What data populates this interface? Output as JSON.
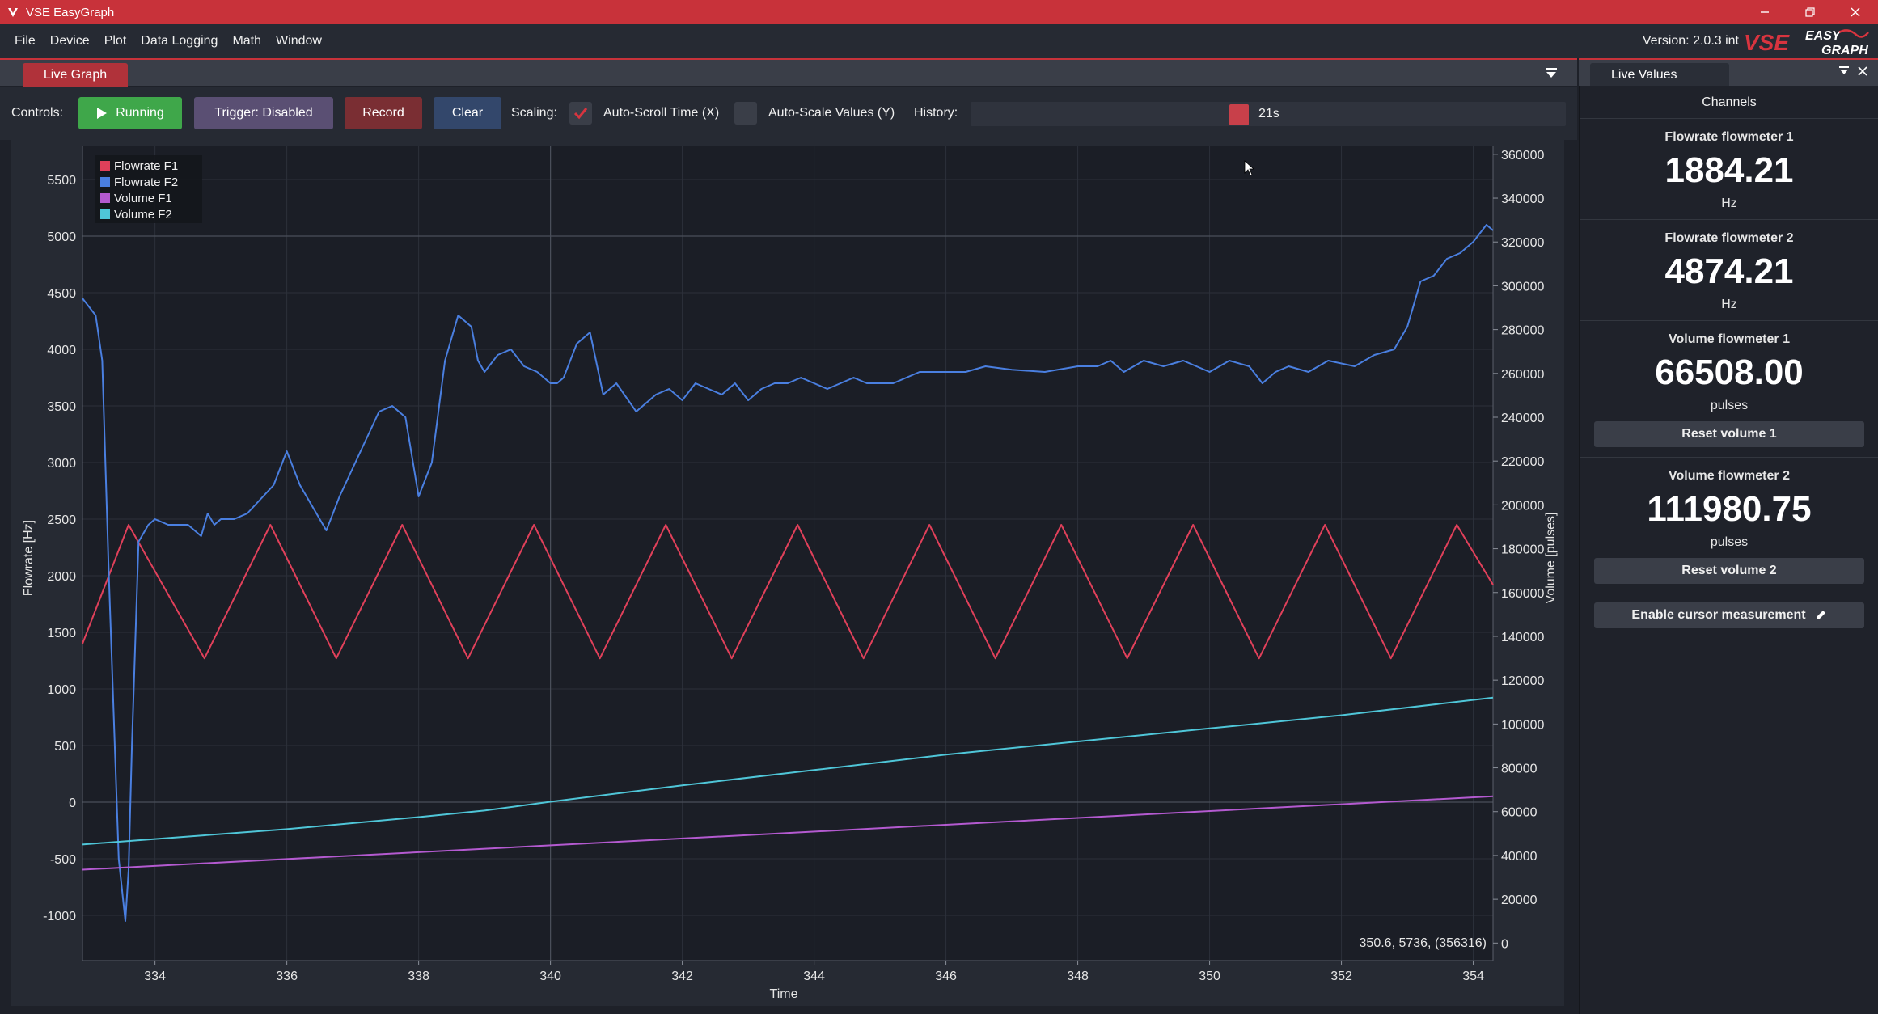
{
  "window": {
    "title": "VSE EasyGraph"
  },
  "menu": [
    "File",
    "Device",
    "Plot",
    "Data Logging",
    "Math",
    "Window"
  ],
  "version_label": "Version: 2.0.3 int",
  "logo": {
    "brand": "VSE",
    "product_line1": "EASY",
    "product_line2": "GRAPH"
  },
  "tabs": {
    "main": "Live Graph",
    "side": "Live Values"
  },
  "controls": {
    "label": "Controls:",
    "running": "Running",
    "trigger": "Trigger: Disabled",
    "record": "Record",
    "clear": "Clear",
    "scaling_label": "Scaling:",
    "autoscroll_label": "Auto-Scroll Time (X)",
    "autoscroll_checked": true,
    "autoscale_label": "Auto-Scale Values (Y)",
    "autoscale_checked": false,
    "history_label": "History:",
    "history_value": "21s"
  },
  "colors": {
    "titlebar": "#c8323a",
    "flowrate_f1": "#e0405a",
    "flowrate_f2": "#4a7fe0",
    "volume_f1": "#b45ad0",
    "volume_f2": "#4fc6d8",
    "running": "#3fa74a"
  },
  "graph": {
    "cursor_readout": "350.6, 5736, (356316)",
    "xlabel": "Time",
    "ylabel_left": "Flowrate [Hz]",
    "ylabel_right": "Volume [pulses]"
  },
  "live_values": {
    "header": "Channels",
    "channels": [
      {
        "name": "Flowrate flowmeter 1",
        "value": "1884.21",
        "unit": "Hz",
        "button": ""
      },
      {
        "name": "Flowrate flowmeter 2",
        "value": "4874.21",
        "unit": "Hz",
        "button": ""
      },
      {
        "name": "Volume flowmeter 1",
        "value": "66508.00",
        "unit": "pulses",
        "button": "Reset volume 1"
      },
      {
        "name": "Volume flowmeter 2",
        "value": "111980.75",
        "unit": "pulses",
        "button": "Reset volume 2"
      }
    ],
    "cursor_button": "Enable cursor measurement"
  },
  "chart_data": {
    "type": "line",
    "title": "",
    "xlabel": "Time",
    "ylabel": "Flowrate [Hz]",
    "y2label": "Volume [pulses]",
    "xlim": [
      332.9,
      354.3
    ],
    "ylim": [
      -1400,
      5800
    ],
    "y2lim": [
      -8000,
      364000
    ],
    "grid": true,
    "legend": "top-left",
    "x_ticks": [
      334,
      336,
      338,
      340,
      342,
      344,
      346,
      348,
      350,
      352,
      354
    ],
    "y_ticks": [
      -1000,
      -500,
      0,
      500,
      1000,
      1500,
      2000,
      2500,
      3000,
      3500,
      4000,
      4500,
      5000,
      5500
    ],
    "y2_ticks": [
      0,
      20000,
      40000,
      60000,
      80000,
      100000,
      120000,
      140000,
      160000,
      180000,
      200000,
      220000,
      240000,
      260000,
      280000,
      300000,
      320000,
      340000,
      360000
    ],
    "series": [
      {
        "name": "Flowrate F1",
        "axis": "left",
        "x": [
          332.9,
          333.6,
          334.75,
          335.75,
          336.75,
          337.75,
          338.75,
          339.75,
          340.75,
          341.75,
          342.75,
          343.75,
          344.75,
          345.75,
          346.75,
          347.75,
          348.75,
          349.75,
          350.75,
          351.75,
          352.75,
          353.75,
          354.3
        ],
        "y": [
          1400,
          2450,
          1270,
          2450,
          1270,
          2450,
          1270,
          2450,
          1270,
          2450,
          1270,
          2450,
          1270,
          2450,
          1270,
          2450,
          1270,
          2450,
          1270,
          2450,
          1270,
          2450,
          1920
        ]
      },
      {
        "name": "Flowrate F2",
        "axis": "left",
        "x": [
          332.9,
          333.1,
          333.2,
          333.3,
          333.45,
          333.55,
          333.6,
          333.65,
          333.75,
          333.9,
          334.0,
          334.2,
          334.5,
          334.7,
          334.8,
          334.9,
          335.0,
          335.2,
          335.4,
          335.8,
          336.0,
          336.2,
          336.4,
          336.6,
          336.8,
          337.0,
          337.2,
          337.4,
          337.6,
          337.8,
          338.0,
          338.2,
          338.4,
          338.6,
          338.8,
          338.9,
          339.0,
          339.2,
          339.4,
          339.6,
          339.8,
          340.0,
          340.1,
          340.2,
          340.4,
          340.6,
          340.8,
          341.0,
          341.3,
          341.6,
          341.8,
          342.0,
          342.2,
          342.4,
          342.6,
          342.8,
          343.0,
          343.2,
          343.4,
          343.6,
          343.8,
          344.0,
          344.2,
          344.4,
          344.6,
          344.8,
          345.2,
          345.6,
          346.0,
          346.3,
          346.6,
          347.0,
          347.5,
          348.0,
          348.3,
          348.5,
          348.7,
          349.0,
          349.3,
          349.6,
          350.0,
          350.3,
          350.6,
          350.8,
          351.0,
          351.2,
          351.5,
          351.8,
          352.2,
          352.5,
          352.8,
          353.0,
          353.2,
          353.4,
          353.6,
          353.8,
          354.0,
          354.2,
          354.3
        ],
        "y": [
          4450,
          4300,
          3900,
          2000,
          -500,
          -1050,
          -600,
          500,
          2300,
          2450,
          2500,
          2450,
          2450,
          2350,
          2550,
          2450,
          2500,
          2500,
          2550,
          2800,
          3100,
          2800,
          2600,
          2400,
          2700,
          2950,
          3200,
          3450,
          3500,
          3400,
          2700,
          3000,
          3900,
          4300,
          4200,
          3900,
          3800,
          3950,
          4000,
          3850,
          3800,
          3700,
          3700,
          3750,
          4050,
          4150,
          3600,
          3700,
          3450,
          3600,
          3650,
          3550,
          3700,
          3650,
          3600,
          3700,
          3550,
          3650,
          3700,
          3700,
          3750,
          3700,
          3650,
          3700,
          3750,
          3700,
          3700,
          3800,
          3800,
          3800,
          3850,
          3820,
          3800,
          3850,
          3850,
          3900,
          3800,
          3900,
          3850,
          3900,
          3800,
          3900,
          3850,
          3700,
          3800,
          3850,
          3800,
          3900,
          3850,
          3950,
          4000,
          4200,
          4600,
          4650,
          4800,
          4850,
          4950,
          5100,
          5050
        ]
      },
      {
        "name": "Volume F1",
        "axis": "right",
        "x": [
          332.9,
          354.3
        ],
        "y": [
          33500,
          67000
        ]
      },
      {
        "name": "Volume F2",
        "axis": "right",
        "x": [
          332.9,
          334.0,
          336.0,
          338.0,
          339.0,
          340.0,
          342.0,
          344.0,
          346.0,
          348.0,
          350.0,
          352.0,
          354.3
        ],
        "y": [
          45000,
          47500,
          52000,
          57500,
          60500,
          64500,
          72000,
          79000,
          86000,
          92000,
          98000,
          104000,
          112000
        ]
      }
    ]
  }
}
